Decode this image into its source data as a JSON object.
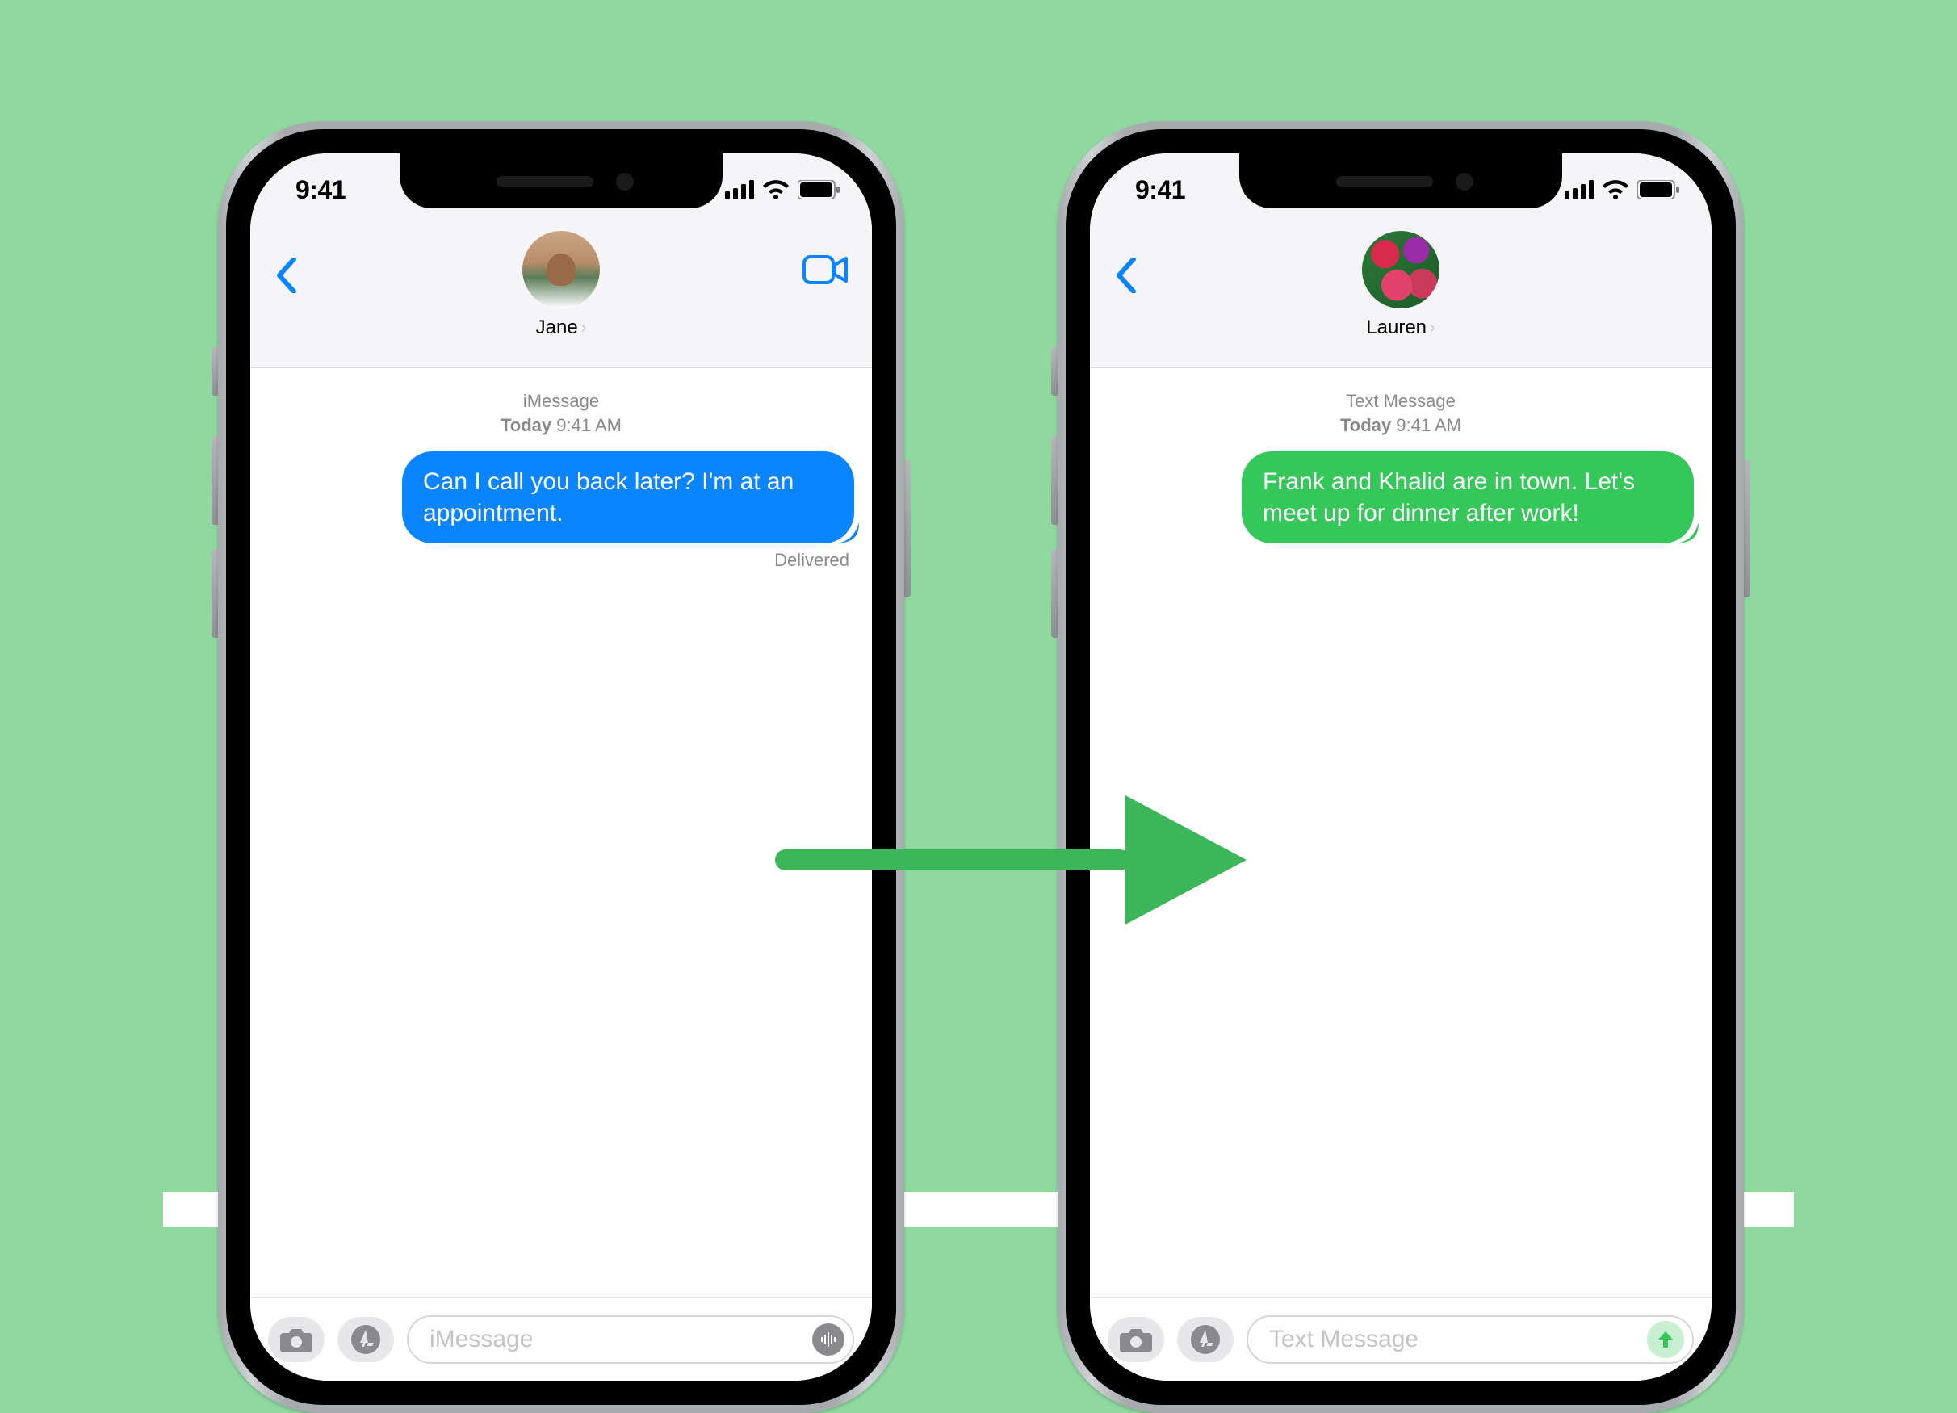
{
  "colors": {
    "imessageBlue": "#0b84ff",
    "smsGreen": "#35c759",
    "arrow": "#3bb759"
  },
  "phones": {
    "left": {
      "status": {
        "time": "9:41"
      },
      "contact": {
        "name": "Jane"
      },
      "thread": {
        "service": "iMessage",
        "dayLabel": "Today",
        "time": "9:41 AM",
        "message": "Can I call you back later? I'm at an appointment.",
        "deliveryStatus": "Delivered"
      },
      "input": {
        "placeholder": "iMessage"
      }
    },
    "right": {
      "status": {
        "time": "9:41"
      },
      "contact": {
        "name": "Lauren"
      },
      "thread": {
        "service": "Text Message",
        "dayLabel": "Today",
        "time": "9:41 AM",
        "message": "Frank and Khalid are in town. Let's meet up for dinner after work!"
      },
      "input": {
        "placeholder": "Text Message"
      }
    }
  }
}
